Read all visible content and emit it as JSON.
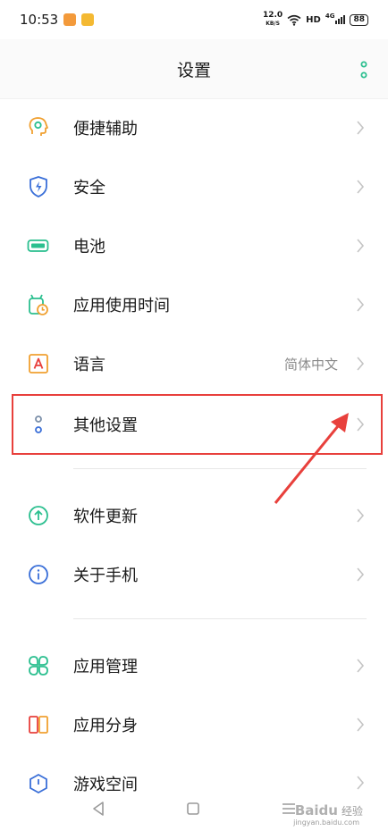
{
  "status_bar": {
    "time": "10:53",
    "net_speed": "12.0",
    "net_unit": "KB/S",
    "hd": "HD",
    "signal": "4G",
    "battery": "88"
  },
  "header": {
    "title": "设置"
  },
  "rows": [
    {
      "label": "便捷辅助",
      "icon": "accessibility-head-icon"
    },
    {
      "label": "安全",
      "icon": "shield-icon"
    },
    {
      "label": "电池",
      "icon": "battery-icon"
    },
    {
      "label": "应用使用时间",
      "icon": "app-timer-icon"
    },
    {
      "label": "语言",
      "value": "简体中文",
      "icon": "letter-a-icon"
    },
    {
      "label": "其他设置",
      "icon": "dots-icon"
    },
    {
      "label": "软件更新",
      "icon": "update-arrow-icon"
    },
    {
      "label": "关于手机",
      "icon": "info-icon"
    },
    {
      "label": "应用管理",
      "icon": "apps-grid-icon"
    },
    {
      "label": "应用分身",
      "icon": "app-clone-icon"
    },
    {
      "label": "游戏空间",
      "icon": "game-space-icon"
    }
  ],
  "watermark": {
    "brand": "Baidu",
    "sub_brand": "经验",
    "url": "jingyan.baidu.com"
  },
  "colors": {
    "accent": "#2bbf8f",
    "highlight": "#e8403c",
    "amber": "#f0a030"
  }
}
